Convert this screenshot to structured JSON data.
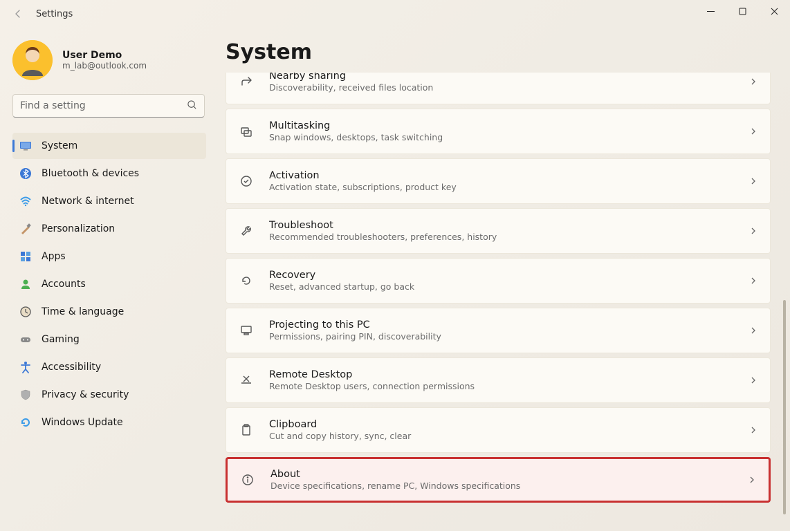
{
  "window": {
    "title": "Settings"
  },
  "user": {
    "name": "User Demo",
    "email": "m_lab@outlook.com"
  },
  "search": {
    "placeholder": "Find a setting"
  },
  "page_title": "System",
  "nav": [
    {
      "id": "system",
      "label": "System",
      "active": true
    },
    {
      "id": "bluetooth",
      "label": "Bluetooth & devices"
    },
    {
      "id": "network",
      "label": "Network & internet"
    },
    {
      "id": "personalization",
      "label": "Personalization"
    },
    {
      "id": "apps",
      "label": "Apps"
    },
    {
      "id": "accounts",
      "label": "Accounts"
    },
    {
      "id": "time-language",
      "label": "Time & language"
    },
    {
      "id": "gaming",
      "label": "Gaming"
    },
    {
      "id": "accessibility",
      "label": "Accessibility"
    },
    {
      "id": "privacy",
      "label": "Privacy & security"
    },
    {
      "id": "update",
      "label": "Windows Update"
    }
  ],
  "items": [
    {
      "id": "nearby-sharing",
      "title": "Nearby sharing",
      "sub": "Discoverability, received files location"
    },
    {
      "id": "multitasking",
      "title": "Multitasking",
      "sub": "Snap windows, desktops, task switching"
    },
    {
      "id": "activation",
      "title": "Activation",
      "sub": "Activation state, subscriptions, product key"
    },
    {
      "id": "troubleshoot",
      "title": "Troubleshoot",
      "sub": "Recommended troubleshooters, preferences, history"
    },
    {
      "id": "recovery",
      "title": "Recovery",
      "sub": "Reset, advanced startup, go back"
    },
    {
      "id": "projecting",
      "title": "Projecting to this PC",
      "sub": "Permissions, pairing PIN, discoverability"
    },
    {
      "id": "remote-desktop",
      "title": "Remote Desktop",
      "sub": "Remote Desktop users, connection permissions"
    },
    {
      "id": "clipboard",
      "title": "Clipboard",
      "sub": "Cut and copy history, sync, clear"
    },
    {
      "id": "about",
      "title": "About",
      "sub": "Device specifications, rename PC, Windows specifications",
      "highlight": true
    }
  ]
}
